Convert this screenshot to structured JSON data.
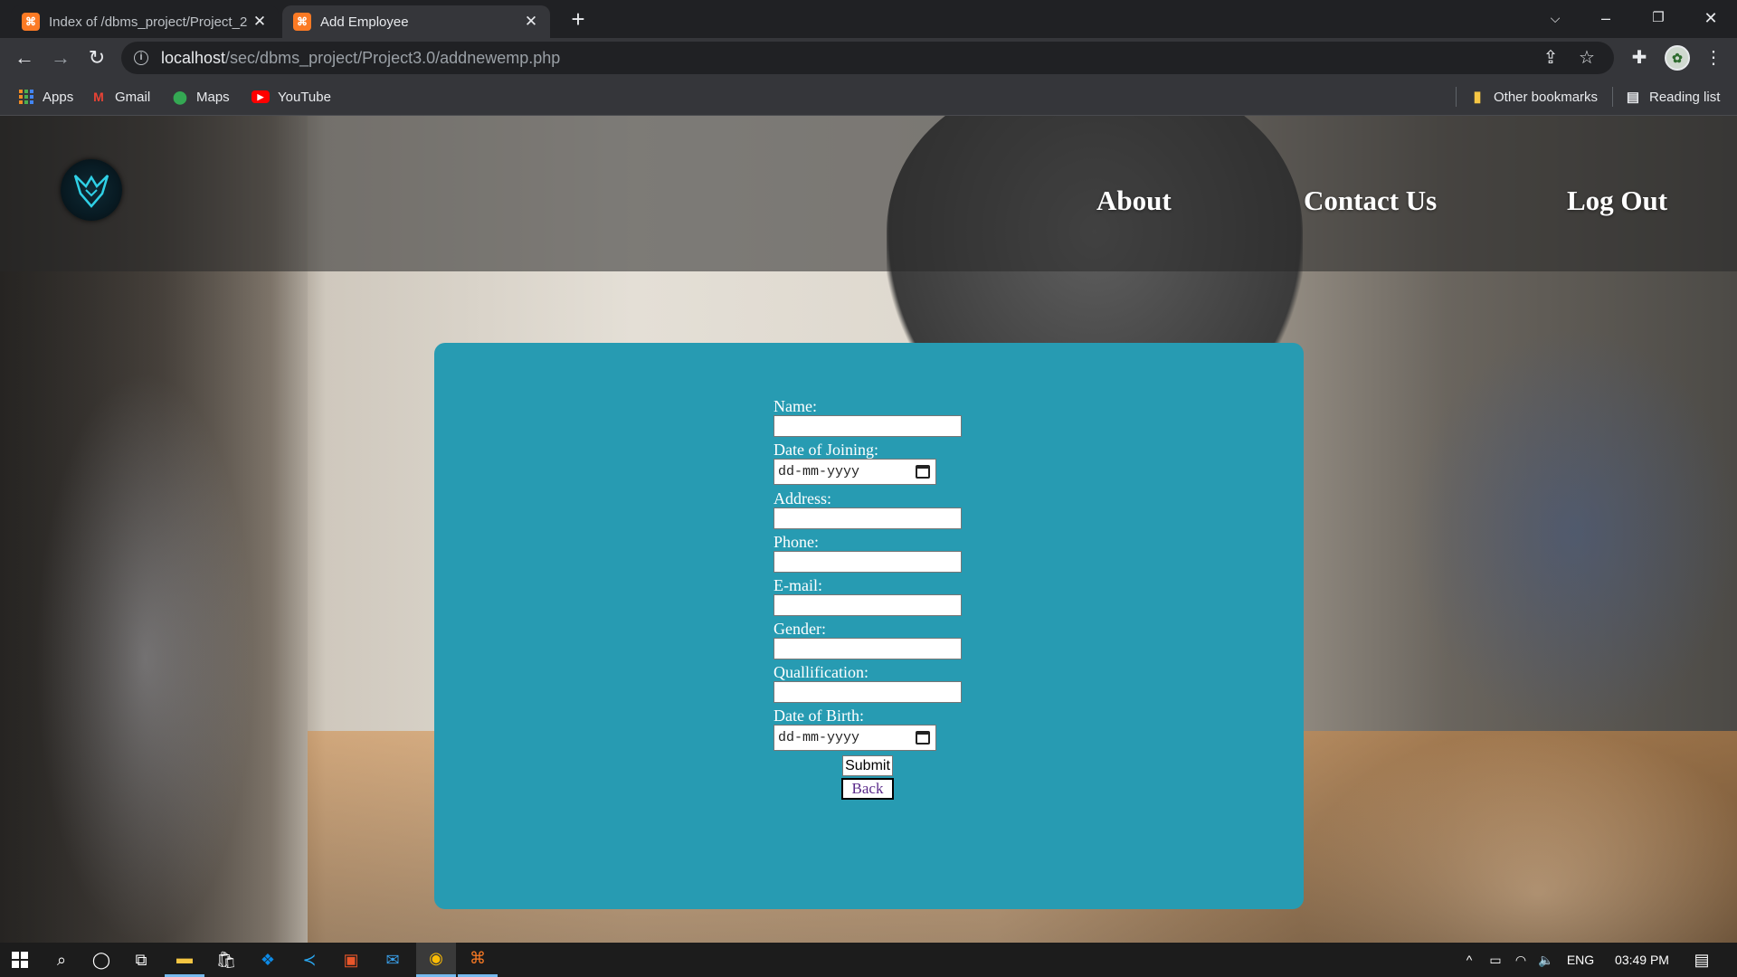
{
  "browser": {
    "tabs": [
      {
        "title": "Index of /dbms_project/Project_2",
        "favicon": "xampp-icon",
        "active": false
      },
      {
        "title": "Add Employee",
        "favicon": "xampp-icon",
        "active": true
      }
    ],
    "url_host": "localhost",
    "url_path": "/sec/dbms_project/Project3.0/addnewemp.php",
    "bookmarks": [
      {
        "label": "Apps",
        "icon": "apps-grid-icon"
      },
      {
        "label": "Gmail",
        "icon": "gmail-icon"
      },
      {
        "label": "Maps",
        "icon": "maps-icon"
      },
      {
        "label": "YouTube",
        "icon": "youtube-icon"
      }
    ],
    "other_bookmarks": "Other bookmarks",
    "reading_list": "Reading list"
  },
  "site": {
    "nav": {
      "about": "About",
      "contact": "Contact Us",
      "logout": "Log Out"
    },
    "form": {
      "name_label": "Name:",
      "doj_label": "Date of Joining:",
      "date_placeholder": "dd-mm-yyyy",
      "address_label": "Address:",
      "phone_label": "Phone:",
      "email_label": "E-mail:",
      "gender_label": "Gender:",
      "qualification_label": "Quallification:",
      "dob_label": "Date of Birth:",
      "submit_label": "Submit",
      "back_label": "Back"
    },
    "colors": {
      "panel": "#279bb2",
      "nav_overlay": "#282828"
    }
  },
  "taskbar": {
    "language": "ENG",
    "time": "03:49 PM"
  }
}
